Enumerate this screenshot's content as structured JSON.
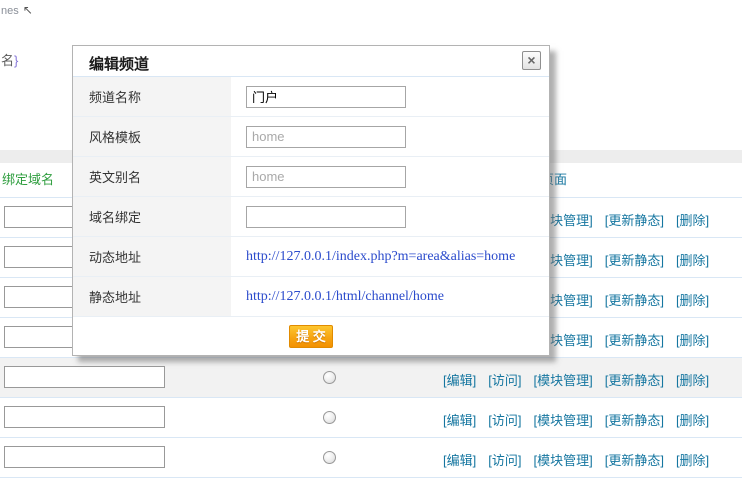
{
  "fragments": {
    "top_text": "nes",
    "cursor": "↖",
    "code_text": "名",
    "code_brace": "}"
  },
  "table": {
    "bound_domain_header": "绑定域名",
    "manage_page_header": "管理页面",
    "actions": [
      {
        "name": "edit-link",
        "label": "[编辑]"
      },
      {
        "name": "visit-link",
        "label": "[访问]"
      },
      {
        "name": "module-manage-link",
        "label": "[模块管理]"
      },
      {
        "name": "update-static-link",
        "label": "[更新静态]"
      },
      {
        "name": "delete-link",
        "label": "[删除]"
      }
    ],
    "row_count": 7,
    "highlighted_row_index": 4,
    "domain_input_value": "",
    "radio_selected": false
  },
  "modal": {
    "title": "编辑频道",
    "close": "×",
    "fields": [
      {
        "name": "channel-name",
        "label": "频道名称",
        "type": "input",
        "value": "门户",
        "placeholder": ""
      },
      {
        "name": "style-template",
        "label": "风格模板",
        "type": "input",
        "value": "",
        "placeholder": "home"
      },
      {
        "name": "english-alias",
        "label": "英文别名",
        "type": "input",
        "value": "",
        "placeholder": "home"
      },
      {
        "name": "domain-binding",
        "label": "域名绑定",
        "type": "input",
        "value": "",
        "placeholder": ""
      },
      {
        "name": "dynamic-url",
        "label": "动态地址",
        "type": "link",
        "value": "http://127.0.0.1/index.php?m=area&alias=home"
      },
      {
        "name": "static-url",
        "label": "静态地址",
        "type": "link",
        "value": "http://127.0.0.1/html/channel/home"
      }
    ],
    "submit": "提 交"
  },
  "colors": {
    "action_link": "#1576a0",
    "domain_header_green": "#2f9e3f",
    "url_link": "#2b4bcc",
    "submit_gradient_top": "#fdc62f",
    "submit_gradient_bottom": "#f39000",
    "row_divider": "#d9e7f5",
    "modal_label_bg": "#f4f4f4"
  }
}
